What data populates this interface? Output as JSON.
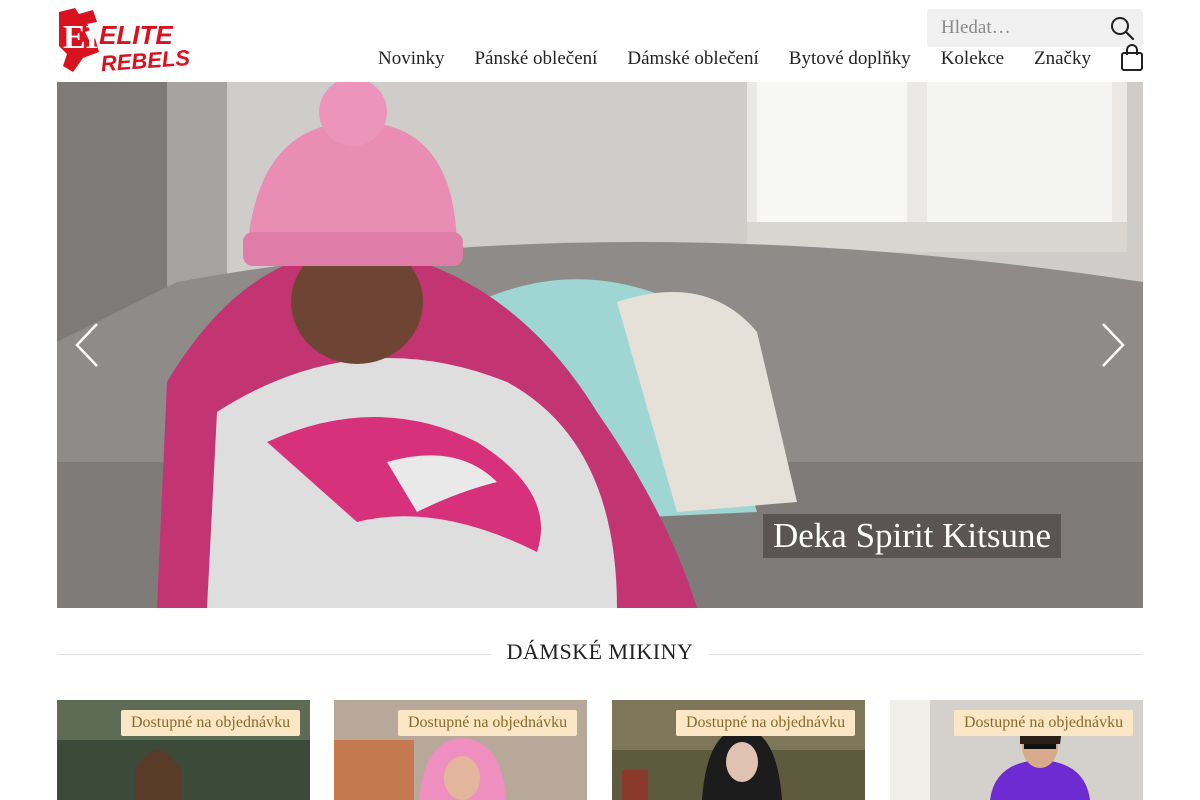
{
  "brand": {
    "name": "Elite Rebels",
    "logo_text_top": "ELITE",
    "logo_text_bottom": "REBELS",
    "logo_letters": "ER",
    "color": "#d8121f"
  },
  "search": {
    "placeholder": "Hledat…",
    "icon": "search-icon"
  },
  "nav": {
    "items": [
      {
        "label": "Novinky"
      },
      {
        "label": "Pánské oblečení"
      },
      {
        "label": "Dámské oblečení"
      },
      {
        "label": "Bytové doplňky"
      },
      {
        "label": "Kolekce"
      },
      {
        "label": "Značky"
      }
    ],
    "cart_icon": "shopping-bag-icon"
  },
  "hero": {
    "caption": "Deka Spirit Kitsune",
    "prev_icon": "chevron-left-icon",
    "next_icon": "chevron-right-icon",
    "accent": "#d6317a"
  },
  "section": {
    "title": "DÁMSKÉ MIKINY"
  },
  "products": [
    {
      "badge": "Dostupné na objednávku"
    },
    {
      "badge": "Dostupné na objednávku"
    },
    {
      "badge": "Dostupné na objednávku"
    },
    {
      "badge": "Dostupné na objednávku"
    }
  ],
  "colors": {
    "badge_bg": "#fbe7c6",
    "badge_text": "#8a6a2c"
  }
}
